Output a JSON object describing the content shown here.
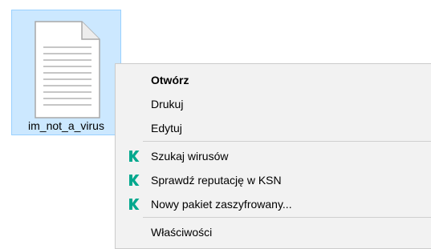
{
  "file": {
    "name": "im_not_a_virus",
    "icon": "text-document-icon"
  },
  "context_menu": {
    "items": [
      {
        "label": "Otwórz",
        "bold": true
      },
      {
        "label": "Drukuj"
      },
      {
        "label": "Edytuj"
      },
      {
        "label": "Szukaj wirusów",
        "icon": "kaspersky-icon"
      },
      {
        "label": "Sprawdź reputację w KSN",
        "icon": "kaspersky-icon"
      },
      {
        "label": "Nowy pakiet zaszyfrowany...",
        "icon": "kaspersky-icon"
      },
      {
        "label": "Właściwości"
      }
    ]
  },
  "colors": {
    "selection_bg": "#cce8ff",
    "selection_border": "#99d1ff",
    "menu_bg": "#f2f2f2",
    "kaspersky_green": "#00a88e"
  }
}
